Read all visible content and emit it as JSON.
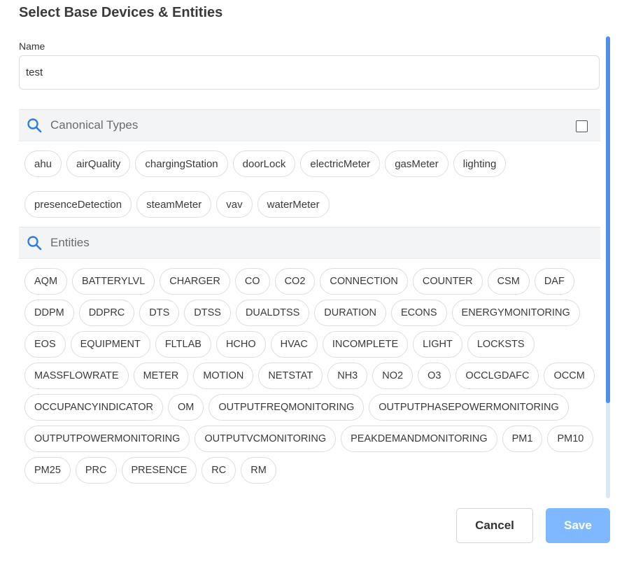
{
  "dialog": {
    "title": "Select Base Devices & Entities",
    "name_label": "Name",
    "name_value": "test"
  },
  "canonical_types": {
    "search_placeholder": "Canonical Types",
    "select_all_checked": false,
    "chips": [
      "ahu",
      "airQuality",
      "chargingStation",
      "doorLock",
      "electricMeter",
      "gasMeter",
      "lighting",
      "presenceDetection",
      "steamMeter",
      "vav",
      "waterMeter"
    ]
  },
  "entities": {
    "search_placeholder": "Entities",
    "chips": [
      "AQM",
      "BATTERYLVL",
      "CHARGER",
      "CO",
      "CO2",
      "CONNECTION",
      "COUNTER",
      "CSM",
      "DAF",
      "DDPM",
      "DDPRC",
      "DTS",
      "DTSS",
      "DUALDTSS",
      "DURATION",
      "ECONS",
      "ENERGYMONITORING",
      "EOS",
      "EQUIPMENT",
      "FLTLAB",
      "HCHO",
      "HVAC",
      "INCOMPLETE",
      "LIGHT",
      "LOCKSTS",
      "MASSFLOWRATE",
      "METER",
      "MOTION",
      "NETSTAT",
      "NH3",
      "NO2",
      "O3",
      "OCCLGDAFC",
      "OCCM",
      "OCCUPANCYINDICATOR",
      "OM",
      "OUTPUTFREQMONITORING",
      "OUTPUTPHASEPOWERMONITORING",
      "OUTPUTPOWERMONITORING",
      "OUTPUTVCMONITORING",
      "PEAKDEMANDMONITORING",
      "PM1",
      "PM10",
      "PM25",
      "PRC",
      "PRESENCE",
      "RC",
      "RM"
    ]
  },
  "footer": {
    "cancel_label": "Cancel",
    "save_label": "Save"
  },
  "colors": {
    "accent": "#4f8fe8",
    "save_disabled": "#7fb8ff",
    "search_bg": "#f3f4f6"
  }
}
